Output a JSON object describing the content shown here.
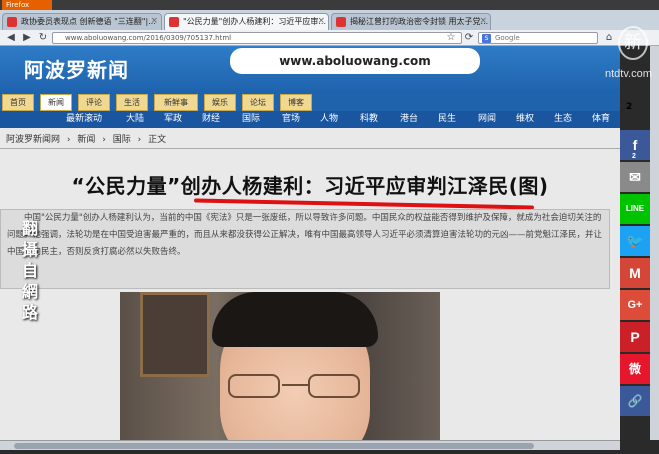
{
  "browser": {
    "app_button": "Firefox",
    "tabs": [
      {
        "label": "政协委员表现点 创新德语 \"三连翻\"|...",
        "active": false
      },
      {
        "label": "\"公民力量\"创办人杨建利：习近平应审...",
        "active": true
      },
      {
        "label": "揭秘江曾打的政治密令封锁 用太子党...",
        "active": false
      }
    ],
    "url": "www.aboluowang.com/2016/0309/705137.html",
    "search_placeholder": "Google"
  },
  "site": {
    "logo": "阿波罗新闻",
    "domain": "www.aboluowang.com",
    "categories": [
      "首页",
      "新闻",
      "评论",
      "生活",
      "新鲜事",
      "娱乐",
      "论坛",
      "博客"
    ],
    "active_category": 1,
    "subnav": [
      "最新滚动",
      "大陆",
      "军政",
      "财经",
      "国际",
      "官场",
      "人物",
      "科教",
      "港台",
      "民生",
      "网闻",
      "维权",
      "生态",
      "体育"
    ],
    "breadcrumb": [
      "阿波罗新闻网",
      "新闻",
      "国际",
      "正文"
    ]
  },
  "article": {
    "headline": "“公民力量”创办人杨建利：习近平应审判江泽民(图)",
    "summary": "中国\"公民力量\"创办人杨建利认为，当前的中国《宪法》只是一张废纸，所以导致许多问题。中国民众的权益能否得到维护及保障，就成为社会迫切关注的问题。他强调，法轮功是在中国受迫害最严重的，而且从来都没获得公正解决，唯有中国最高领导人习近平必须清算迫害法轮功的元凶——前党魁江泽民，并让中国迈向民主，否则反贪打腐必然以失败告终。"
  },
  "social": {
    "share_count": "2",
    "facebook_count": "2",
    "buttons": [
      {
        "name": "facebook-share",
        "glyph": "f",
        "color": "#3b5998"
      },
      {
        "name": "email-share",
        "glyph": "✉",
        "color": "#888888"
      },
      {
        "name": "line-share",
        "glyph": "LINE",
        "color": "#00c300"
      },
      {
        "name": "twitter-share",
        "glyph": "🐦",
        "color": "#1da1f2"
      },
      {
        "name": "gmail-share",
        "glyph": "M",
        "color": "#d44638"
      },
      {
        "name": "googleplus-share",
        "glyph": "G+",
        "color": "#dd4b39"
      },
      {
        "name": "pinterest-share",
        "glyph": "P",
        "color": "#cb2027"
      },
      {
        "name": "weibo-share",
        "glyph": "微",
        "color": "#e6162d"
      },
      {
        "name": "copy-link-share",
        "glyph": "🔗",
        "color": "#3b5998"
      }
    ]
  },
  "overlay": {
    "ntd_mark": "新",
    "ntd_text": "ntdtv.com",
    "caption_vertical": "翻攝自網路"
  }
}
